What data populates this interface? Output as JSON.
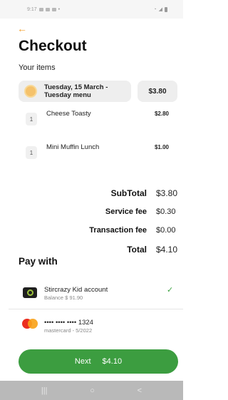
{
  "status_bar": {
    "time": "9:17"
  },
  "header": {
    "back_icon": "arrow-left-icon",
    "title": "Checkout"
  },
  "items_section": {
    "label": "Your items",
    "menu": {
      "label": "Tuesday, 15 March -\nTuesday menu",
      "price": "$3.80"
    },
    "items": [
      {
        "qty": "1",
        "name": "Cheese Toasty",
        "price": "$2.80"
      },
      {
        "qty": "1",
        "name": "Mini Muffin Lunch",
        "price": "$1.00"
      }
    ]
  },
  "summary": {
    "subtotal_label": "SubTotal",
    "subtotal": "$3.80",
    "service_fee_label": "Service fee",
    "service_fee": "$0.30",
    "transaction_fee_label": "Transaction fee",
    "transaction_fee": "$0.00",
    "total_label": "Total",
    "total": "$4.10"
  },
  "payment": {
    "label": "Pay with",
    "account": {
      "title": "Stircrazy Kid account",
      "subtitle": "Balance $ 91.90"
    },
    "card": {
      "title": "•••• •••• •••• 1324",
      "subtitle": "mastercard - 5/2022"
    }
  },
  "next_button": {
    "label": "Next",
    "amount": "$4.10"
  },
  "nav_bar": {
    "recents": "|||",
    "home": "○",
    "back": "<"
  },
  "colors": {
    "accent": "#f2a02a",
    "primary": "#3c9d40",
    "check": "#3fa443"
  }
}
